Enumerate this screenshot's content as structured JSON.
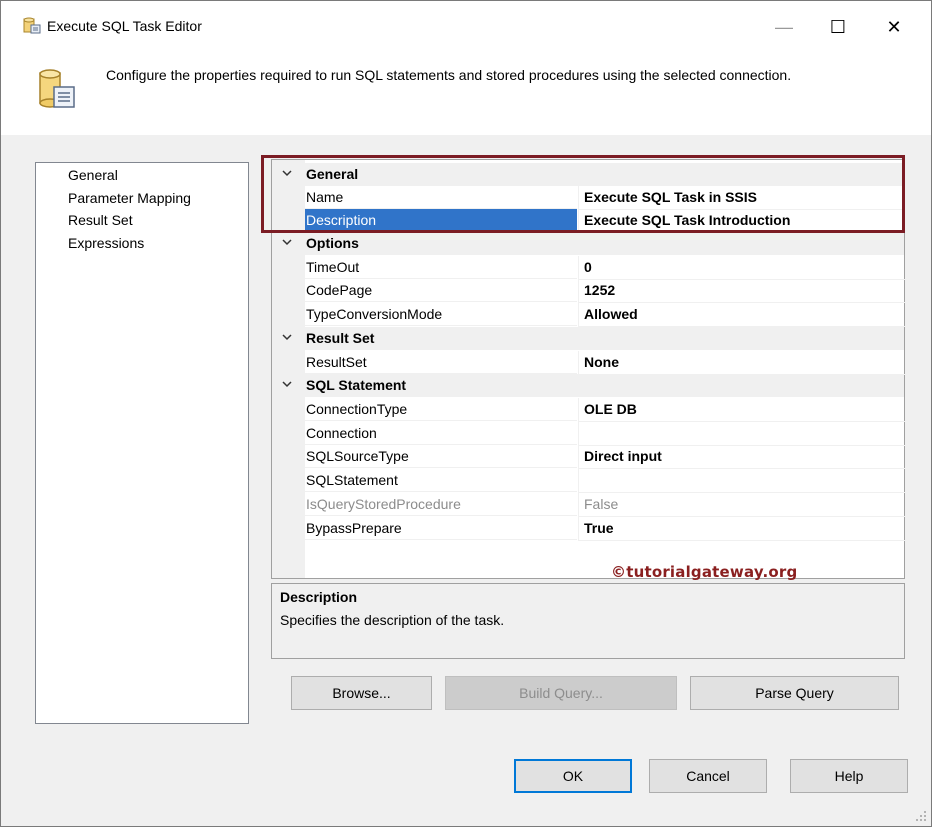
{
  "window": {
    "title": "Execute SQL Task Editor",
    "controls": {
      "minimize": "—",
      "maximize": "☐",
      "close": "✕"
    }
  },
  "header": {
    "icon": "task-editor-icon",
    "text": "Configure the properties required to run SQL statements and stored procedures using the selected connection."
  },
  "nav": {
    "items": [
      {
        "label": "General",
        "selected": true
      },
      {
        "label": "Parameter Mapping"
      },
      {
        "label": "Result Set"
      },
      {
        "label": "Expressions"
      }
    ]
  },
  "properties": {
    "general": {
      "label": "General",
      "name": {
        "label": "Name",
        "value": "Execute SQL Task in SSIS"
      },
      "description": {
        "label": "Description",
        "value": "Execute SQL Task Introduction"
      }
    },
    "options": {
      "label": "Options",
      "timeout": {
        "label": "TimeOut",
        "value": "0"
      },
      "codepage": {
        "label": "CodePage",
        "value": "1252"
      },
      "typeconversion": {
        "label": "TypeConversionMode",
        "value": "Allowed"
      }
    },
    "resultset": {
      "label": "Result Set",
      "resultset": {
        "label": "ResultSet",
        "value": "None"
      }
    },
    "sql": {
      "label": "SQL Statement",
      "connectiontype": {
        "label": "ConnectionType",
        "value": "OLE DB"
      },
      "connection": {
        "label": "Connection",
        "value": ""
      },
      "sqlsourcetype": {
        "label": "SQLSourceType",
        "value": "Direct input"
      },
      "sqlstatement": {
        "label": "SQLStatement",
        "value": ""
      },
      "isquerystored": {
        "label": "IsQueryStoredProcedure",
        "value": "False"
      },
      "bypassprepare": {
        "label": "BypassPrepare",
        "value": "True"
      }
    }
  },
  "watermark": "©tutorialgateway.org",
  "description_panel": {
    "title": "Description",
    "text": "Specifies the description of the task."
  },
  "buttons": {
    "browse": "Browse...",
    "build_query": "Build Query...",
    "parse_query": "Parse Query",
    "ok": "OK",
    "cancel": "Cancel",
    "help": "Help"
  },
  "colors": {
    "selection": "#3074c9",
    "highlight_box": "#7b1c24",
    "watermark": "#8a1f1f"
  }
}
